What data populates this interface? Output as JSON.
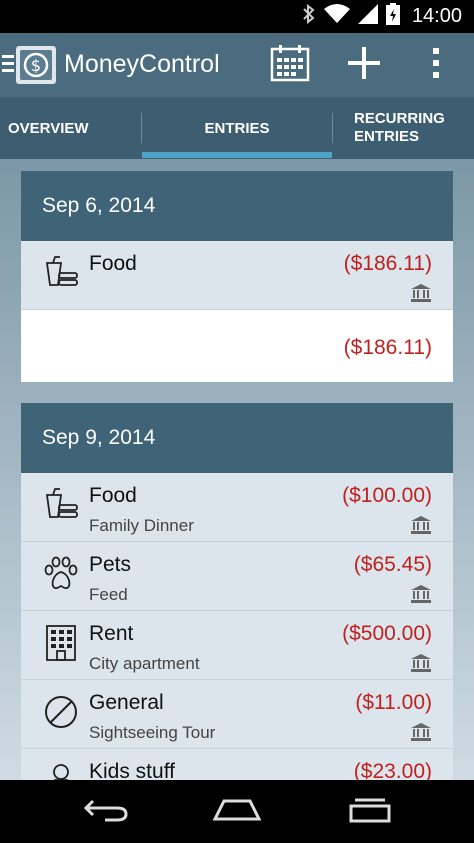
{
  "status_bar": {
    "time": "14:00"
  },
  "app": {
    "title": "MoneyControl"
  },
  "tabs": [
    {
      "label": "OVERVIEW"
    },
    {
      "label": "ENTRIES"
    },
    {
      "label_line1": "RECURRING",
      "label_line2": "ENTRIES"
    }
  ],
  "groups": [
    {
      "date": "Sep 6, 2014",
      "entries": [
        {
          "icon": "food-icon",
          "name": "Food",
          "description": "",
          "amount": "($186.11)"
        }
      ],
      "total": "($186.11)"
    },
    {
      "date": "Sep 9, 2014",
      "entries": [
        {
          "icon": "food-icon",
          "name": "Food",
          "description": "Family Dinner",
          "amount": "($100.00)"
        },
        {
          "icon": "paw-icon",
          "name": "Pets",
          "description": "Feed",
          "amount": "($65.45)"
        },
        {
          "icon": "building-icon",
          "name": "Rent",
          "description": "City apartment",
          "amount": "($500.00)"
        },
        {
          "icon": "prohibited-icon",
          "name": "General",
          "description": "Sightseeing Tour",
          "amount": "($11.00)"
        },
        {
          "icon": "child-icon",
          "name": "Kids stuff",
          "description": "",
          "amount": "($23.00)"
        }
      ]
    }
  ],
  "colors": {
    "action_bar": "#4a6c7e",
    "tabs": "#3c5e70",
    "tab_indicator": "#4fa3c9",
    "card_header": "#3f6477",
    "amount_negative": "#c0201f",
    "entry_bg": "#dbe5eb"
  }
}
